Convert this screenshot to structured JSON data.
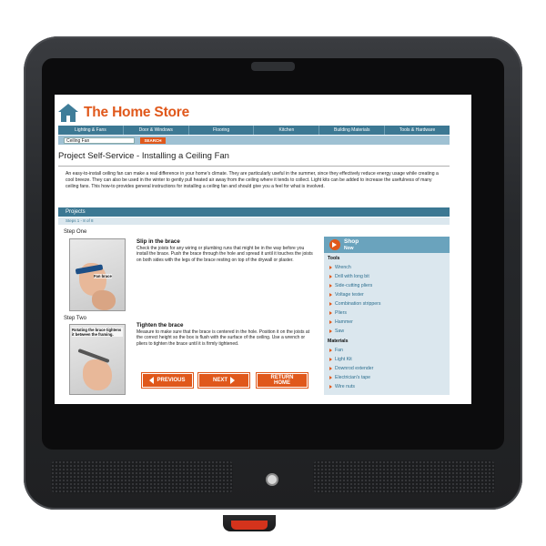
{
  "header": {
    "brand": "The Home Store"
  },
  "nav": [
    "Lighting & Fans",
    "Door & Windows",
    "Flooring",
    "Kitchen",
    "Building Materials",
    "Tools & Hardware"
  ],
  "search": {
    "value": "Ceiling Fan",
    "button": "SEARCH"
  },
  "page": {
    "title": "Project Self-Service  - Installing a Ceiling Fan",
    "intro": "An easy-to-install ceiling fan can make a real difference in your home's climate. They are particularly useful in the summer, since they effectively reduce energy usage while creating a cool breeze. They can also be used in the winter to gently pull heated air away from the ceiling where it tends to collect. Light kits can be added to increase the usefulness of many ceiling fans. This how-to provides general instructions for installing a ceiling fan and should give you a feel for what is involved."
  },
  "projects": {
    "label": "Projects",
    "count": "Steps 1 - 8 of 8"
  },
  "steps": [
    {
      "label": "Step One",
      "image_caption": "Fan brace",
      "title": "Slip in the brace",
      "text": "Check the joists for any wiring or plumbing runs that might be in the way before you install the brace. Push the brace through the hole and spread it until it touches the joists on both sides with the legs of the brace resting on top of the drywall or plaster."
    },
    {
      "label": "Step Two",
      "image_caption": "Rotating the brace tightens it between the framing.",
      "title": "Tighten the brace",
      "text": "Measure to make sure that the brace is centered in the hole. Position it on the joists at the correct height so the box is flush with the surface of the ceiling. Use a wrench or pliers to tighten the brace until it is firmly tightened."
    }
  ],
  "buttons": {
    "previous": "PREVIOUS",
    "next": "NEXT",
    "return_line1": "RETURN",
    "return_line2": "HOME"
  },
  "shop": {
    "title": "Shop",
    "subtitle": "Now",
    "tools_label": "Tools",
    "tools": [
      "Wrench",
      "Drill with long bit",
      "Side-cutting pliers",
      "Voltage tester",
      "Combination strippers",
      "Pliers",
      "Hammer",
      "Saw"
    ],
    "materials_label": "Materials",
    "materials": [
      "Fan",
      "Light Kit",
      "Downrod extender",
      "Electrician's tape",
      "Wire nuts"
    ]
  },
  "colors": {
    "accent": "#e0581b",
    "nav": "#3c7893",
    "panel": "#dbe7ee"
  }
}
